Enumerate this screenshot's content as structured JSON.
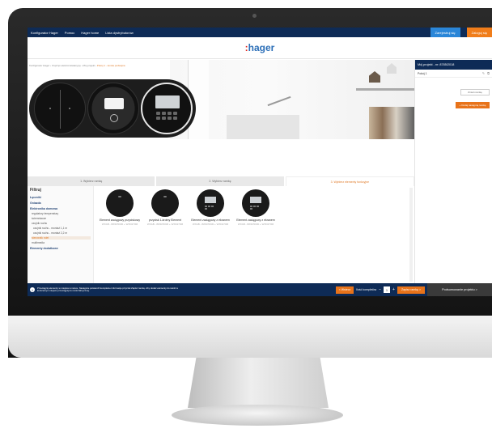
{
  "nav": {
    "items": [
      "Konfigurator Hager",
      "Pomoc",
      "Hager home",
      "Lista dystrybutorów"
    ],
    "login_label": "Zarejestruj się",
    "register_label": "Zaloguj się"
  },
  "logo": {
    "colon": ":",
    "text": "hager"
  },
  "breadcrumb": {
    "path": "Konfigurator Hager › Osprzęt elektroinstalacyjny › Mój projekt ›",
    "current": "Pokój 1 - ramka podwójna"
  },
  "steps": [
    "1. Wybierz ramkę",
    "2. Wybierz ramkę",
    "3. Wybierz elementy funkcyjne"
  ],
  "filter": {
    "title": "Filtruj",
    "categories": [
      {
        "label": "Łączniki",
        "subs": []
      },
      {
        "label": "Gniazda",
        "subs": []
      },
      {
        "label": "Elektronika domowa",
        "subs": [
          {
            "label": "regulatory temperatury",
            "indent": false,
            "active": false
          },
          {
            "label": "ściemniacze",
            "indent": false,
            "active": false
          },
          {
            "label": "czujnik ruchu",
            "indent": false,
            "active": false
          },
          {
            "label": "czujnik ruchu - montaż 1,1 m",
            "indent": true,
            "active": false
          },
          {
            "label": "czujnik ruchu - montaż 2,2 m",
            "indent": true,
            "active": false
          },
          {
            "label": "sterownik rolet",
            "indent": false,
            "active": true
          },
          {
            "label": "multimedia",
            "indent": false,
            "active": false
          }
        ]
      },
      {
        "label": "Elementy dodatkowe",
        "subs": []
      }
    ]
  },
  "products": [
    {
      "name": "Element zaciągowy przyciskowy",
      "code": "WXAB - 8W1P0030 + WXD270M"
    },
    {
      "name": "przycisk 1-krotny Element",
      "code": "WXAB - 8W1P0030 + WXD270M"
    },
    {
      "name": "Element zaciągowy z ekranem",
      "code": "WXAB - 8W1P0030 + WXD270M"
    },
    {
      "name": "Element zaciągowy z ekranem",
      "code": "WXAB - 8W1P0030 + WXD270M"
    }
  ],
  "project": {
    "title": "Mój projekt - nr: 8785/2018",
    "room": "Pokój 1",
    "room_edit_icon": "edit-icon",
    "change_frame_label": "Zmień ramkę",
    "add_label": "+ Dodaj następną ramkę"
  },
  "bottom": {
    "info": "Przeciągnij elementy w miejsca w ramce. Następnie potwierdź kompletne informacje przycisk Zapisz ramkę. Aby dodać elementy do ramki w konkretnym miejscu przeciągnij do ramki fabrycznej.",
    "back_label": "< Wstecz",
    "qty_label": "Ilość kompletów",
    "qty_value": "1",
    "next_label": "Zapisz ramkę >",
    "summary_label": "Podsumowanie projektu >"
  },
  "colors": {
    "navy": "#0e2b56",
    "orange": "#e8731a",
    "logo_blue": "#2c6fb8",
    "logo_red": "#e2231a"
  }
}
